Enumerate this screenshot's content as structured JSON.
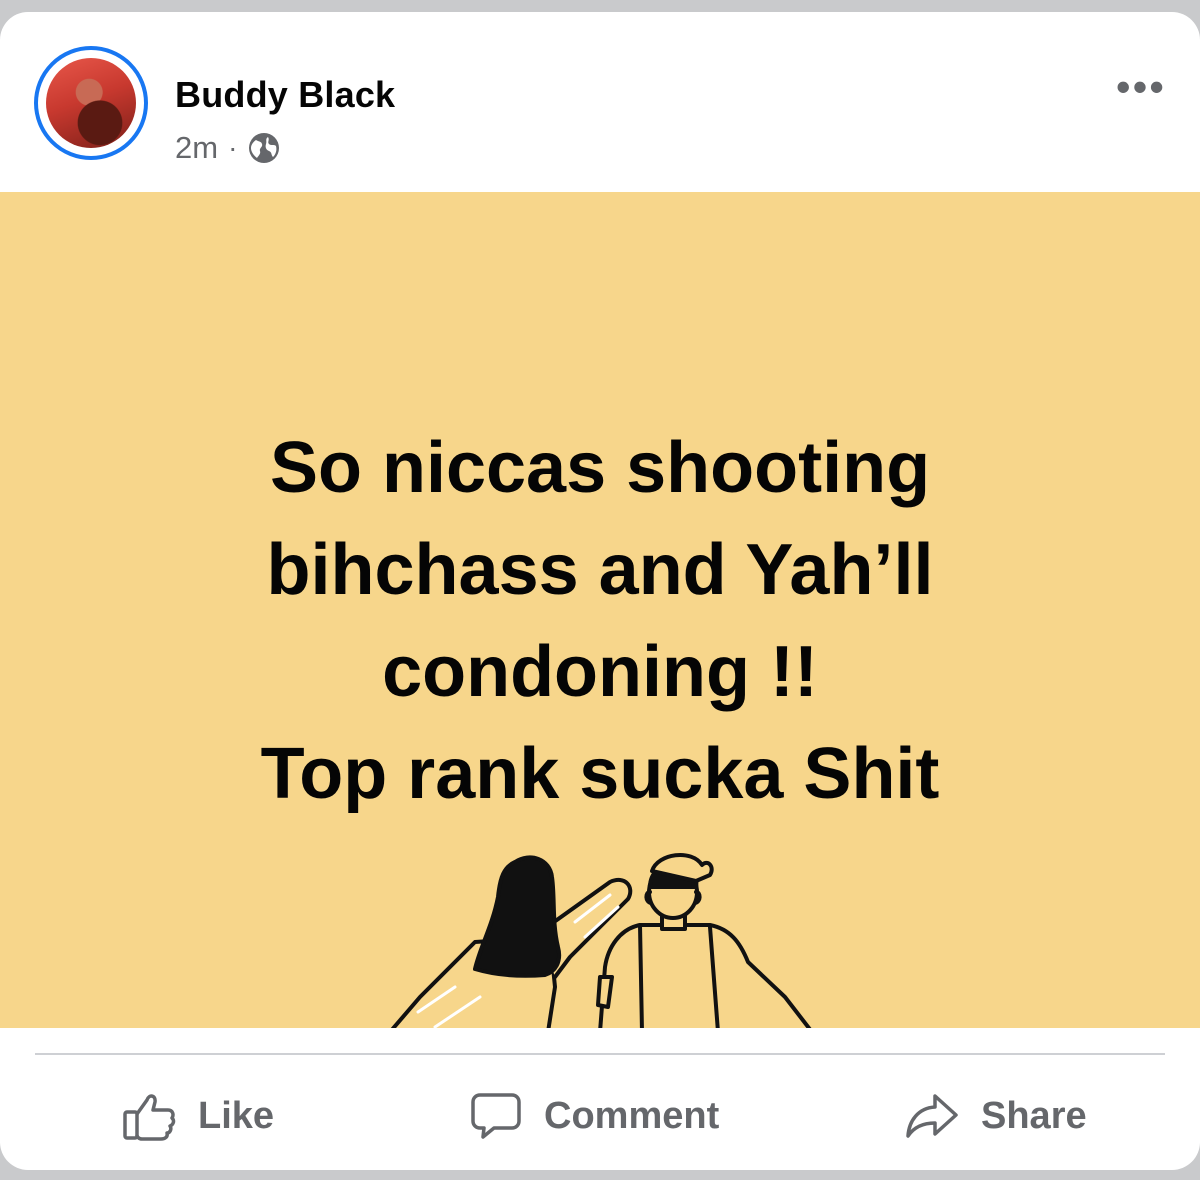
{
  "post": {
    "author": "Buddy Black",
    "timestamp": "2m",
    "separator": "·",
    "audience_icon": "globe-icon",
    "menu_icon": "•••",
    "text": "So niccas shooting\nbihchass and Yah’ll\ncondoning !!\nTop rank sucka Shit",
    "background_color": "#f7d68b",
    "illustration": "two-friends-illustration"
  },
  "actions": {
    "like_label": "Like",
    "comment_label": "Comment",
    "share_label": "Share"
  },
  "colors": {
    "accent": "#1877f2",
    "secondary_text": "#65676b"
  }
}
